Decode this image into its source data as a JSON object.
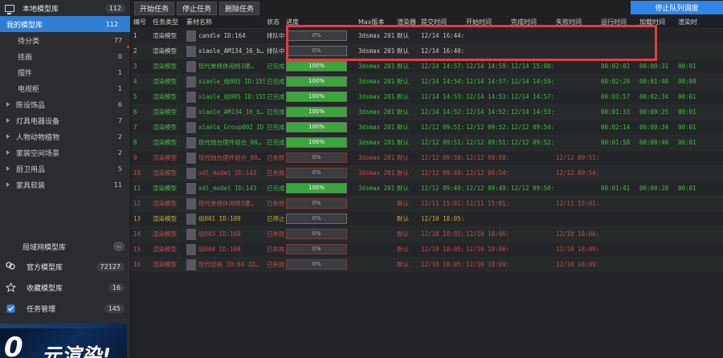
{
  "sidebar": {
    "header": {
      "label": "本地模型库",
      "count": "112"
    },
    "my_library": {
      "label": "我的模型库",
      "count": "112"
    },
    "items": [
      {
        "label": "待分类",
        "count": "77"
      },
      {
        "label": "挂画",
        "count": "0"
      },
      {
        "label": "摆件",
        "count": "1"
      },
      {
        "label": "电视柜",
        "count": "1"
      }
    ],
    "categories": [
      {
        "label": "陈设饰品",
        "count": "6"
      },
      {
        "label": "灯具电器设备",
        "count": "7"
      },
      {
        "label": "人物动物植物",
        "count": "2"
      },
      {
        "label": "家装空间场景",
        "count": "2"
      },
      {
        "label": "厨卫用品",
        "count": "5"
      },
      {
        "label": "家具软装",
        "count": "11"
      }
    ],
    "lan": {
      "label": "局域网模型库",
      "more": ".."
    },
    "official": {
      "label": "官方模型库",
      "count": "72127"
    },
    "favorites": {
      "label": "收藏模型库",
      "count": "16"
    },
    "tasks": {
      "label": "任务管理",
      "count": "145"
    },
    "banner": {
      "big": "0",
      "text": "元渲染!"
    }
  },
  "toolbar": {
    "start": "开始任务",
    "stop": "停止任务",
    "delete": "删除任务",
    "schedule": "停止队列调度"
  },
  "columns": [
    "编号",
    "任务类型",
    "素材名称",
    "状态",
    "进度",
    "Max版本",
    "渲染器",
    "提交时间",
    "开始时间",
    "完成时间",
    "失败时间",
    "运行时间",
    "加载时间",
    "渲染时"
  ],
  "rows": [
    {
      "id": "1",
      "type": "渲染模型",
      "name": "candle ID:164",
      "status": "排队中",
      "kind": "queue",
      "progress": "0%",
      "pct": 0,
      "max": "3dsmax 2015",
      "renderer": "默认",
      "submit": "12/14 16:44:40",
      "start": "",
      "finish": "",
      "fail": "",
      "run": "",
      "load": "",
      "render": ""
    },
    {
      "id": "2",
      "type": "渲染模型",
      "name": "xiaole_AM134_16_b…",
      "status": "排队中",
      "kind": "queue",
      "progress": "0%",
      "pct": 0,
      "max": "3dsmax 2016",
      "renderer": "默认",
      "submit": "12/14 16:40:53",
      "start": "",
      "finish": "",
      "fail": "",
      "run": "",
      "load": "",
      "render": ""
    },
    {
      "id": "3",
      "type": "渲染模型",
      "name": "现代单椅休闲椅3建…",
      "status": "已完成",
      "kind": "done",
      "progress": "100%",
      "pct": 100,
      "max": "3dsmax 2016",
      "renderer": "默认",
      "submit": "12/14 14:57:47",
      "start": "12/14 14:59:10",
      "finish": "12/14 15:00:45",
      "fail": "",
      "run": "00:02:02",
      "load": "00:00:31",
      "render": "00:01"
    },
    {
      "id": "4",
      "type": "渲染模型",
      "name": "xiaole_组005 ID:155",
      "status": "已完成",
      "kind": "done",
      "progress": "100%",
      "pct": 100,
      "max": "3dsmax 2014",
      "renderer": "默认",
      "submit": "12/14 14:54:29",
      "start": "12/14 14:57:20",
      "finish": "12/14 14:59:09",
      "fail": "",
      "run": "00:02:20",
      "load": "00:01:40",
      "render": "00:00"
    },
    {
      "id": "5",
      "type": "渲染模型",
      "name": "xiaole_组005 ID:155",
      "status": "已完成",
      "kind": "done",
      "progress": "100%",
      "pct": 100,
      "max": "3dsmax 2014",
      "renderer": "默认",
      "submit": "12/14 14:53:46",
      "start": "12/14 14:53:52",
      "finish": "12/14 14:57:19",
      "fail": "",
      "run": "00:03:57",
      "load": "00:02:34",
      "render": "00:01"
    },
    {
      "id": "6",
      "type": "渲染模型",
      "name": "xiaole_AM134_16_b…",
      "status": "已完成",
      "kind": "done",
      "progress": "100%",
      "pct": 100,
      "max": "3dsmax 2013",
      "renderer": "默认",
      "submit": "12/14 14:52:38",
      "start": "12/14 14:52:38",
      "finish": "12/14 14:53:50",
      "fail": "",
      "run": "00:01:33",
      "load": "00:00:25",
      "render": "00:01"
    },
    {
      "id": "7",
      "type": "渲染模型",
      "name": "xiaole_Group002 ID:…",
      "status": "已完成",
      "kind": "done",
      "progress": "100%",
      "pct": 100,
      "max": "3dsmax 2012",
      "renderer": "默认",
      "submit": "12/12 09:51:21",
      "start": "12/12 09:52:36",
      "finish": "12/12 09:54:20",
      "fail": "",
      "run": "00:02:14",
      "load": "00:00:34",
      "render": "00:01"
    },
    {
      "id": "8",
      "type": "渲染模型",
      "name": "现代烛台摆件组合_00…",
      "status": "已完成",
      "kind": "done",
      "progress": "100%",
      "pct": 100,
      "max": "3dsmax 2014",
      "renderer": "默认",
      "submit": "12/12 09:51:05",
      "start": "12/12 09:51:14",
      "finish": "12/12 09:52:35",
      "fail": "",
      "run": "00:01:58",
      "load": "00:00:40",
      "render": "00:01"
    },
    {
      "id": "9",
      "type": "渲染模型",
      "name": "现代烛台摆件组合_00…",
      "status": "已失败",
      "kind": "fail",
      "progress": "0%",
      "pct": 0,
      "max": "3dsmax 2012",
      "renderer": "默认",
      "submit": "12/12 09:50:56",
      "start": "12/12 09:50:58",
      "finish": "",
      "fail": "12/12 09:51:13",
      "run": "",
      "load": "",
      "render": ""
    },
    {
      "id": "10",
      "type": "渲染模型",
      "name": "xdl_model ID:143",
      "status": "已失败",
      "kind": "fail",
      "progress": "0%",
      "pct": 0,
      "max": "3dsmax 2012",
      "renderer": "默认",
      "submit": "12/12 09:49:41",
      "start": "12/12 09:54:21",
      "finish": "",
      "fail": "12/12 09:54:43",
      "run": "",
      "load": "",
      "render": ""
    },
    {
      "id": "11",
      "type": "渲染模型",
      "name": "xdl_model ID:143",
      "status": "已完成",
      "kind": "done",
      "progress": "100%",
      "pct": 100,
      "max": "3dsmax 2015",
      "renderer": "默认",
      "submit": "12/12 09:49:27",
      "start": "12/12 09:49:28",
      "finish": "12/12 09:50:50",
      "fail": "",
      "run": "00:01:41",
      "load": "00:00:28",
      "render": "00:01"
    },
    {
      "id": "12",
      "type": "渲染模型",
      "name": "现代单椅休闲椅3建…",
      "status": "已失败",
      "kind": "fail",
      "progress": "0%",
      "pct": 0,
      "max": "",
      "renderer": "默认",
      "submit": "12/11 15:01:20",
      "start": "12/11 15:01:25",
      "finish": "",
      "fail": "12/11 15:01:58",
      "run": "",
      "load": "",
      "render": ""
    },
    {
      "id": "13",
      "type": "渲染模型",
      "name": "组001 ID:109",
      "status": "已停止",
      "kind": "stop",
      "progress": "0%",
      "pct": 0,
      "max": "",
      "renderer": "默认",
      "submit": "12/10 18:05:50",
      "start": "",
      "finish": "",
      "fail": "",
      "run": "",
      "load": "",
      "render": ""
    },
    {
      "id": "14",
      "type": "渲染模型",
      "name": "组003 ID:109",
      "status": "已失败",
      "kind": "fail",
      "progress": "0%",
      "pct": 0,
      "max": "",
      "renderer": "默认",
      "submit": "12/10 18:05:44",
      "start": "12/10 18:06:07",
      "finish": "",
      "fail": "12/10 18:06:40",
      "run": "",
      "load": "",
      "render": ""
    },
    {
      "id": "15",
      "type": "渲染模型",
      "name": "组004 ID:108",
      "status": "已失败",
      "kind": "fail",
      "progress": "0%",
      "pct": 0,
      "max": "",
      "renderer": "默认",
      "submit": "12/10 18:05:42",
      "start": "12/10 18:06:41",
      "finish": "",
      "fail": "12/10 18:09:09",
      "run": "",
      "load": "",
      "render": ""
    },
    {
      "id": "16",
      "type": "渲染模型",
      "name": "现代挂画 ID:64 ID…",
      "status": "已失败",
      "kind": "fail",
      "progress": "0%",
      "pct": 0,
      "max": "",
      "renderer": "默认",
      "submit": "12/10 18:05:40",
      "start": "12/10 18:09:10",
      "finish": "",
      "fail": "12/10 18:09:37",
      "run": "",
      "load": "",
      "render": ""
    }
  ],
  "colors": {
    "accent": "#2f86e6",
    "done": "#3fbf3f",
    "fail": "#c94a4a",
    "stop": "#c7ab32",
    "highlight": "#e53d3d"
  }
}
